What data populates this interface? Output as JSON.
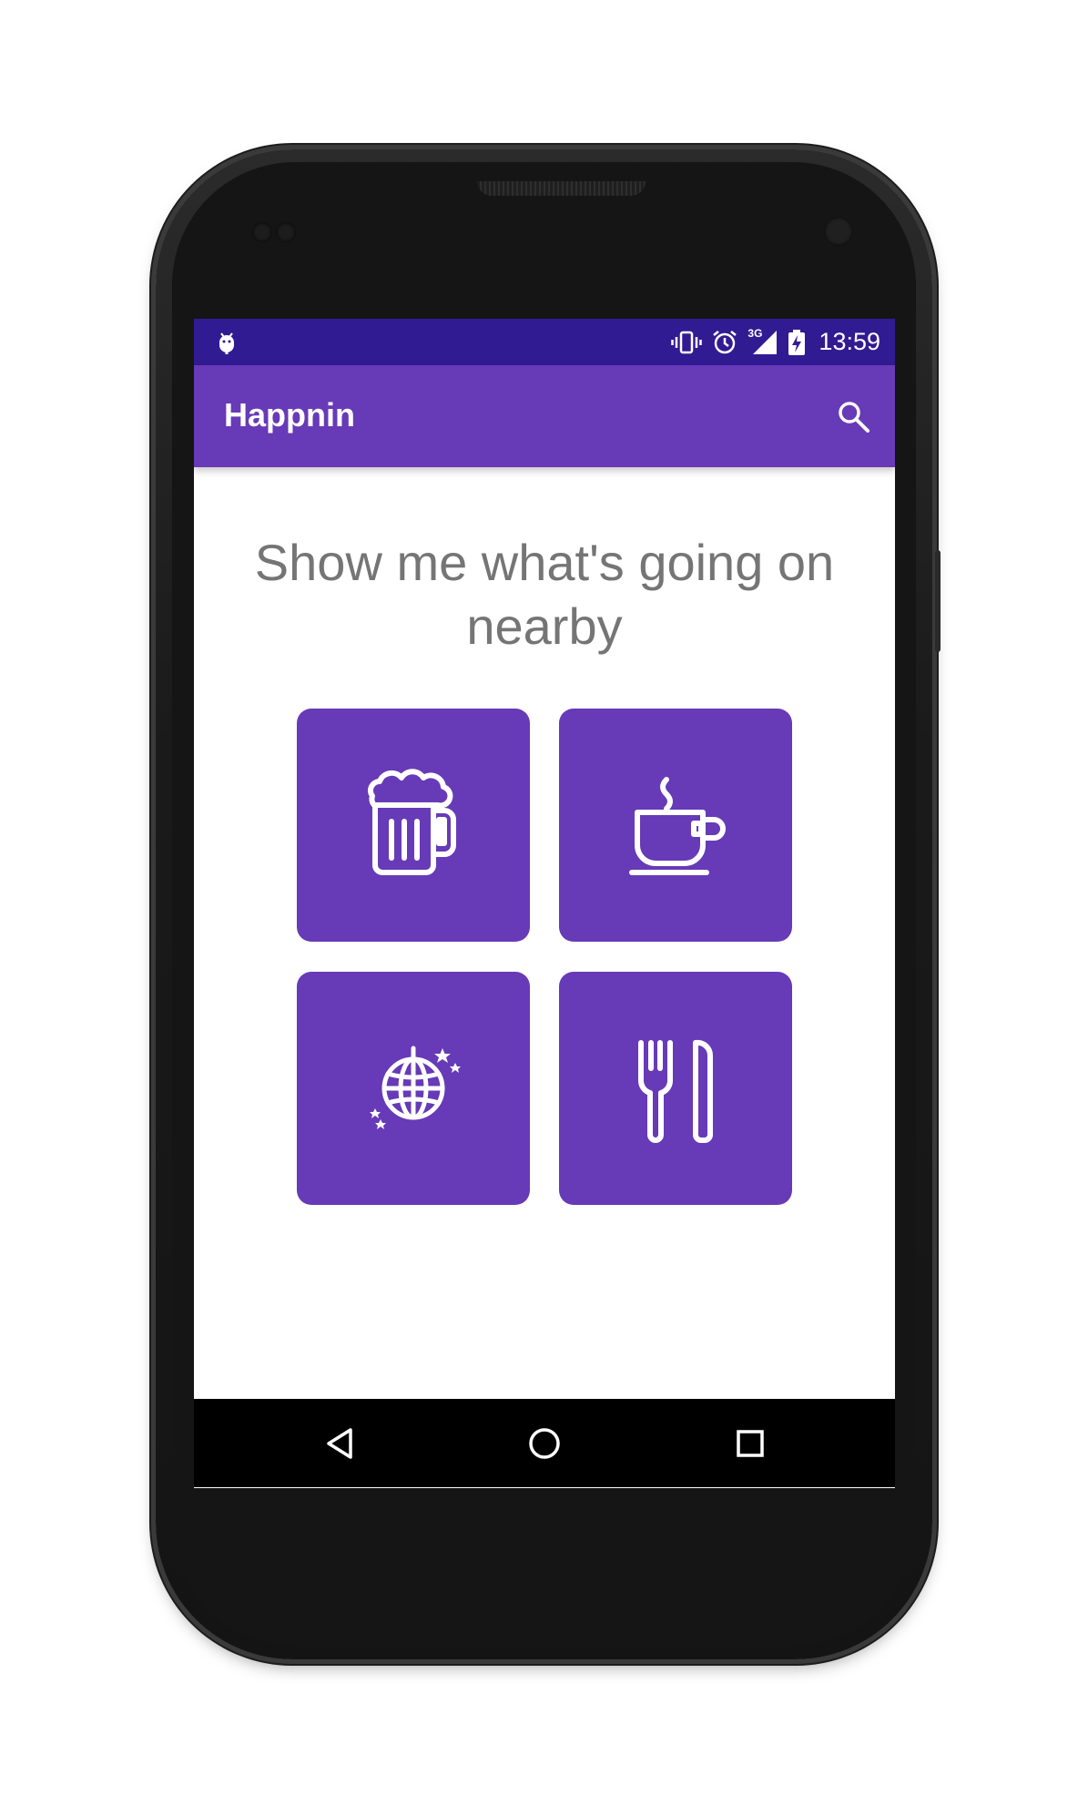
{
  "status_bar": {
    "time": "13:59",
    "network_label": "3G",
    "icons": [
      "android-debug-icon",
      "vibrate-icon",
      "alarm-icon",
      "signal-3g-icon",
      "battery-charging-icon"
    ]
  },
  "app_bar": {
    "title": "Happnin",
    "actions": [
      "search-icon"
    ]
  },
  "main": {
    "headline": "Show me what's going on nearby",
    "categories": [
      {
        "icon": "beer-mug-icon"
      },
      {
        "icon": "coffee-cup-icon"
      },
      {
        "icon": "disco-ball-icon"
      },
      {
        "icon": "fork-knife-icon"
      }
    ]
  },
  "navigation": {
    "buttons": [
      "back-icon",
      "home-icon",
      "recents-icon"
    ]
  },
  "colors": {
    "status_bar": "#311b92",
    "primary": "#673ab7",
    "headline_text": "#757575",
    "background": "#ffffff",
    "nav_bar": "#000000"
  }
}
